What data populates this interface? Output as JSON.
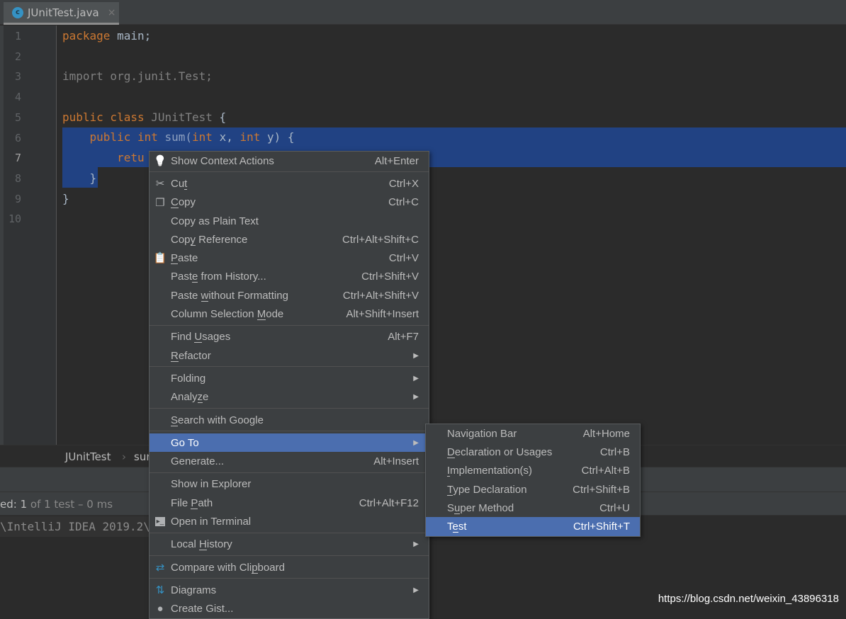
{
  "tab": {
    "title": "JUnitTest.java",
    "icon": "class-icon",
    "close": "×"
  },
  "lines": [
    "1",
    "2",
    "3",
    "4",
    "5",
    "6",
    "7",
    "8",
    "9",
    "10"
  ],
  "code": {
    "l1": {
      "kw": "package",
      "rest": " main;"
    },
    "l3": "import org.junit.Test;",
    "l5": {
      "kw": "public class",
      "name": " JUnitTest",
      "rest": " {"
    },
    "l6": {
      "a": "    public int",
      "b": " sum(",
      "c": "int",
      "d": " x, ",
      "e": "int",
      "f": " y) {"
    },
    "l7": "        retu",
    "l8": "    }",
    "l9": "}"
  },
  "breadcrumb": {
    "class": "JUnitTest",
    "sep": "›",
    "method": "sur"
  },
  "status": {
    "prefix": "ed: ",
    "count": "1",
    "rest": " of 1 test – 0 ms"
  },
  "console": "\\IntelliJ IDEA 2019.2\\",
  "watermark": "https://blog.csdn.net/weixin_43896318",
  "context_menu": [
    {
      "label": "Show Context Actions",
      "shortcut": "Alt+Enter",
      "icon": "lightbulb-icon"
    },
    {
      "sep": true
    },
    {
      "label": "Cut",
      "mn": 2,
      "shortcut": "Ctrl+X",
      "icon": "scissors-icon"
    },
    {
      "label": "Copy",
      "mn": 0,
      "shortcut": "Ctrl+C",
      "icon": "copy-icon"
    },
    {
      "label": "Copy as Plain Text",
      "shortcut": ""
    },
    {
      "label": "Copy Reference",
      "mn": 3,
      "shortcut": "Ctrl+Alt+Shift+C"
    },
    {
      "label": "Paste",
      "mn": 0,
      "shortcut": "Ctrl+V",
      "icon": "clipboard-icon"
    },
    {
      "label": "Paste from History...",
      "mn": 4,
      "shortcut": "Ctrl+Shift+V"
    },
    {
      "label": "Paste without Formatting",
      "mn": 6,
      "shortcut": "Ctrl+Alt+Shift+V"
    },
    {
      "label": "Column Selection Mode",
      "mn": 17,
      "shortcut": "Alt+Shift+Insert"
    },
    {
      "sep": true
    },
    {
      "label": "Find Usages",
      "mn": 5,
      "shortcut": "Alt+F7"
    },
    {
      "label": "Refactor",
      "mn": 0,
      "submenu": true
    },
    {
      "sep": true
    },
    {
      "label": "Folding",
      "submenu": true
    },
    {
      "label": "Analyze",
      "mn": 5,
      "submenu": true
    },
    {
      "sep": true
    },
    {
      "label": "Search with Google",
      "mn": 0
    },
    {
      "sep": true
    },
    {
      "label": "Go To",
      "submenu": true,
      "highlighted": true
    },
    {
      "label": "Generate...",
      "shortcut": "Alt+Insert"
    },
    {
      "sep": true
    },
    {
      "label": "Show in Explorer"
    },
    {
      "label": "File Path",
      "mn": 5,
      "shortcut": "Ctrl+Alt+F12"
    },
    {
      "label": "Open in Terminal",
      "icon": "terminal-icon"
    },
    {
      "sep": true
    },
    {
      "label": "Local History",
      "mn": 6,
      "submenu": true
    },
    {
      "sep": true
    },
    {
      "label": "Compare with Clipboard",
      "mn": 16,
      "icon": "compare-icon"
    },
    {
      "sep": true
    },
    {
      "label": "Diagrams",
      "submenu": true,
      "icon": "diagram-icon"
    },
    {
      "label": "Create Gist...",
      "icon": "github-icon"
    }
  ],
  "goto_submenu": [
    {
      "label": "Navigation Bar",
      "shortcut": "Alt+Home"
    },
    {
      "label": "Declaration or Usages",
      "mn": 0,
      "shortcut": "Ctrl+B"
    },
    {
      "label": "Implementation(s)",
      "mn": 0,
      "shortcut": "Ctrl+Alt+B"
    },
    {
      "label": "Type Declaration",
      "mn": 0,
      "shortcut": "Ctrl+Shift+B"
    },
    {
      "label": "Super Method",
      "mn": 1,
      "shortcut": "Ctrl+U"
    },
    {
      "label": "Test",
      "mn": 1,
      "shortcut": "Ctrl+Shift+T",
      "highlighted": true
    }
  ],
  "colors": {
    "highlight": "#4b6eaf",
    "selection": "#214283",
    "keyword": "#cc7832"
  }
}
